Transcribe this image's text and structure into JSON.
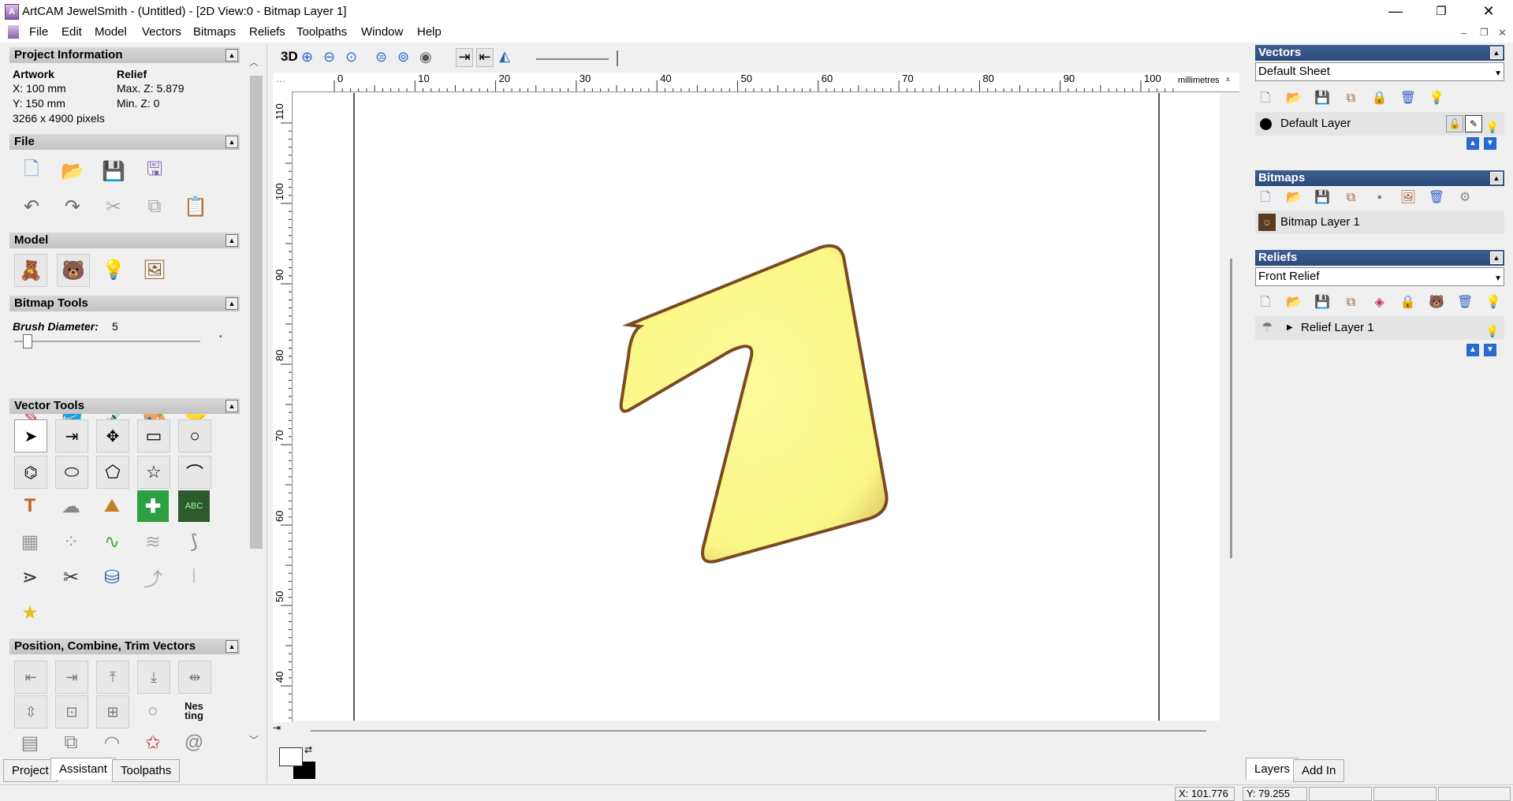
{
  "window": {
    "title": "ArtCAM JewelSmith - (Untitled) - [2D View:0 - Bitmap Layer 1]",
    "minimize": "—",
    "restore": "❐",
    "close": "✕"
  },
  "menu": [
    "File",
    "Edit",
    "Model",
    "Vectors",
    "Bitmaps",
    "Reliefs",
    "Toolpaths",
    "Window",
    "Help"
  ],
  "project_info": {
    "header": "Project Information",
    "artwork_label": "Artwork",
    "relief_label": "Relief",
    "x": "X: 100 mm",
    "y": "Y: 150 mm",
    "pixels": "3266 x 4900 pixels",
    "maxz": "Max. Z: 5.879",
    "minz": "Min. Z: 0"
  },
  "sections": {
    "file": "File",
    "model": "Model",
    "bitmap_tools": "Bitmap Tools",
    "vector_tools": "Vector Tools",
    "position": "Position, Combine, Trim Vectors"
  },
  "brush": {
    "label": "Brush Diameter:",
    "value": "5",
    "slider_fraction": 0.05
  },
  "left_tabs": [
    "Project",
    "Assistant",
    "Toolpaths"
  ],
  "view_toolbar": {
    "mode_3d": "3D"
  },
  "ruler": {
    "h_ticks": [
      "0",
      "10",
      "20",
      "30",
      "40",
      "50",
      "60",
      "70",
      "80",
      "90",
      "100"
    ],
    "v_ticks": [
      "110",
      "100",
      "90",
      "80",
      "70",
      "60",
      "50",
      "40"
    ],
    "units": "millimetres"
  },
  "shape": {
    "fill": "#fbf787",
    "edge": "#7a4a22"
  },
  "vectors_panel": {
    "header": "Vectors",
    "sheet": "Default Sheet",
    "layer": "Default Layer"
  },
  "bitmaps_panel": {
    "header": "Bitmaps",
    "layer": "Bitmap Layer 1"
  },
  "reliefs_panel": {
    "header": "Reliefs",
    "relief": "Front Relief",
    "layer": "Relief Layer 1"
  },
  "right_tabs": [
    "Layers",
    "Add In"
  ],
  "status": {
    "x": "X: 101.776",
    "y": "Y: 79.255"
  },
  "colors": {
    "panel_header_blue": "#2f4f80",
    "background": "#f0f0f0"
  }
}
